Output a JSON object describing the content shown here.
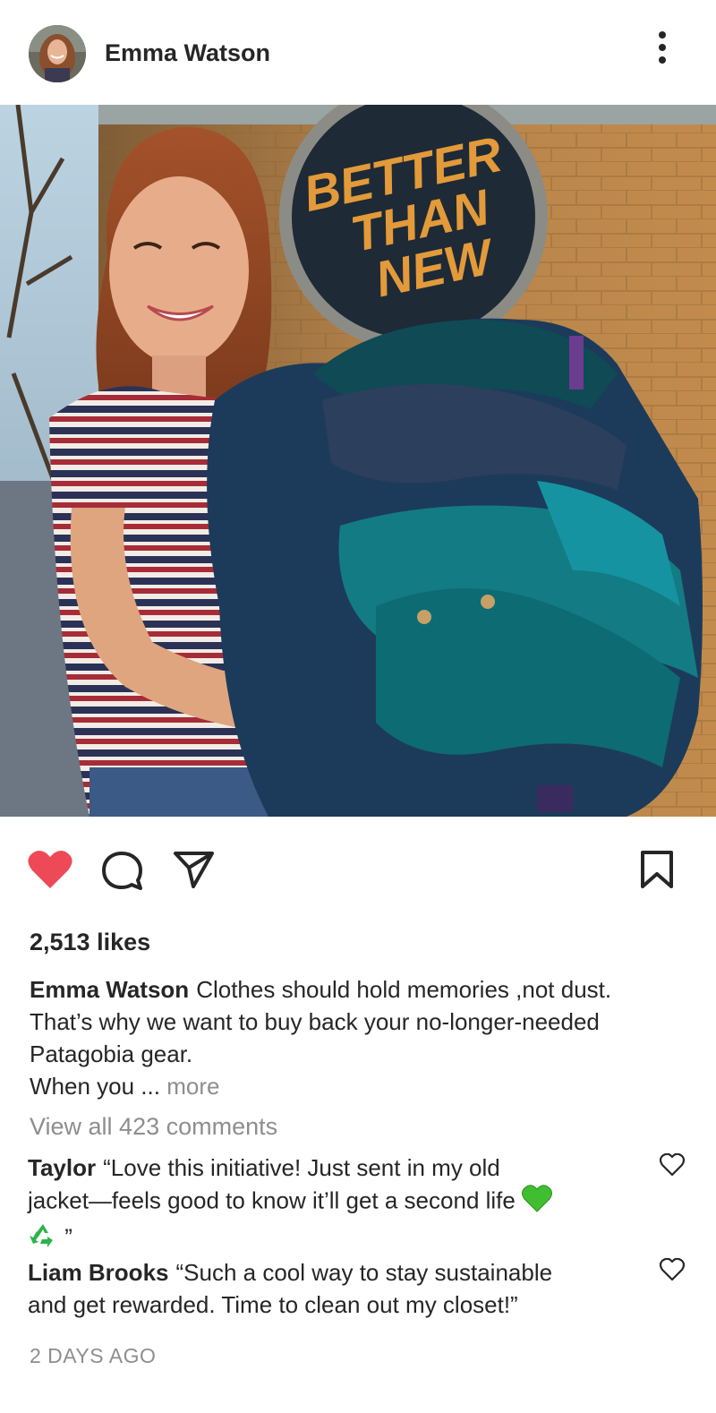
{
  "post": {
    "username": "Emma Watson",
    "sign_text": [
      "BETTER",
      "THAN",
      "NEW"
    ],
    "likes": "2,513 likes",
    "caption": {
      "username": "Emma Watson",
      "line1": "Clothes should hold memories ,not dust.",
      "line2": "That’s why we want to buy back your no-longer-needed",
      "line3": "Patagobia gear.",
      "line4": "When you ...",
      "more": "more"
    },
    "view_all_comments": "View all 423 comments",
    "comments": [
      {
        "username": "Taylor",
        "text_line1": "“Love this initiative! Just sent in my old",
        "text_line2": "jacket—feels good to know it’ll get a second life",
        "text_line3": "”"
      },
      {
        "username": "Liam Brooks",
        "text_line1": "“Such a cool way to stay sustainable",
        "text_line2": "and get rewarded. Time to clean out my closet!”"
      }
    ],
    "timestamp": "2 DAYS AGO"
  },
  "icons": {
    "more": "more-vertical-icon",
    "like": "heart-filled-icon",
    "comment": "comment-bubble-icon",
    "share": "paper-plane-icon",
    "save": "bookmark-icon",
    "comment_like": "heart-outline-icon",
    "green_heart": "green-heart-emoji",
    "recycle": "recycle-emoji"
  },
  "colors": {
    "like_red": "#ed4956",
    "muted_text": "#8e8e8e",
    "text": "#262626",
    "sign_text": "#e39a3a"
  }
}
